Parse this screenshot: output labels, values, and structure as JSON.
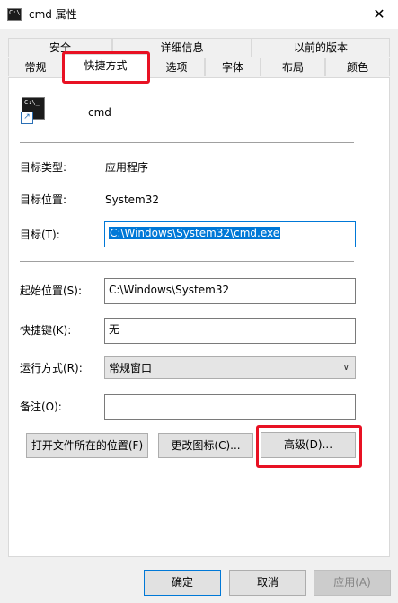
{
  "window": {
    "title": "cmd 属性",
    "close_glyph": "✕"
  },
  "tabs": {
    "row_top": [
      "安全",
      "详细信息",
      "以前的版本"
    ],
    "row_bottom": [
      "常规",
      "快捷方式",
      "选项",
      "字体",
      "布局",
      "颜色"
    ],
    "active": "快捷方式"
  },
  "shortcut": {
    "name": "cmd",
    "icon_text": "C:\\_",
    "icon_overlay": "↗",
    "target_type_label": "目标类型:",
    "target_type_value": "应用程序",
    "target_location_label": "目标位置:",
    "target_location_value": "System32",
    "target_label": "目标(T):",
    "target_value": "C:\\Windows\\System32\\cmd.exe",
    "start_in_label": "起始位置(S):",
    "start_in_value": "C:\\Windows\\System32",
    "hotkey_label": "快捷键(K):",
    "hotkey_value": "无",
    "run_label": "运行方式(R):",
    "run_value": "常规窗口",
    "comment_label": "备注(O):",
    "comment_value": ""
  },
  "buttons": {
    "open_location": "打开文件所在的位置(F)",
    "change_icon": "更改图标(C)...",
    "advanced": "高级(D)...",
    "ok": "确定",
    "cancel": "取消",
    "apply": "应用(A)"
  },
  "colors": {
    "highlight": "#e81123",
    "accent": "#0078d7"
  }
}
